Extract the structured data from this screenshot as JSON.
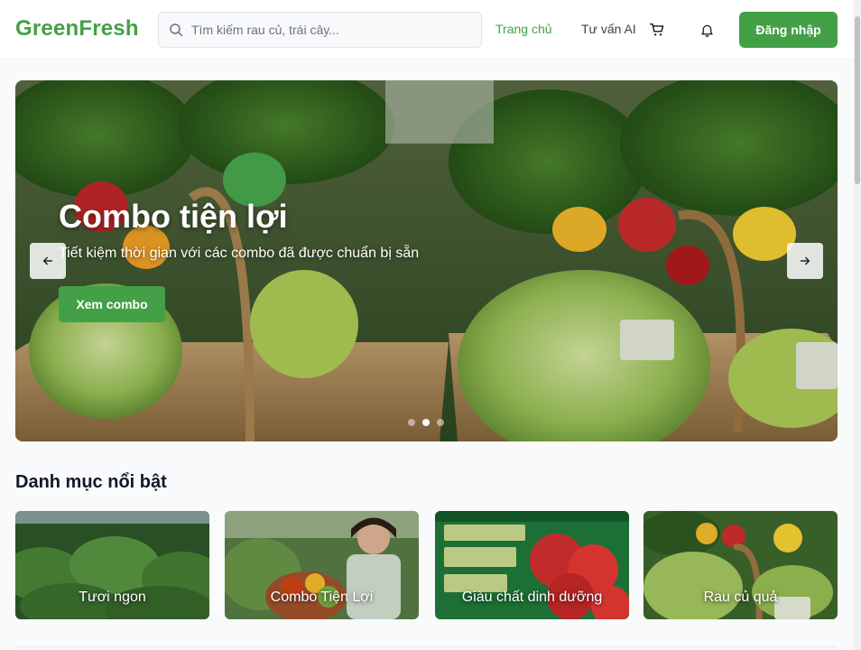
{
  "header": {
    "logo": "GreenFresh",
    "search_placeholder": "Tìm kiếm rau củ, trái cây...",
    "nav": [
      {
        "label": "Trang chủ",
        "active": true
      },
      {
        "label": "Tư vấn AI",
        "active": false
      }
    ],
    "icons": [
      "search-icon",
      "cart-icon",
      "bell-icon"
    ],
    "login_label": "Đăng nhập"
  },
  "hero": {
    "title": "Combo tiện lợi",
    "subtitle": "Tiết kiệm thời gian với các combo đã được chuẩn bị sẵn",
    "button_label": "Xem combo",
    "slide_count": 3,
    "active_slide": 2
  },
  "categories": {
    "title": "Danh mục nổi bật",
    "items": [
      {
        "label": "Tươi ngon"
      },
      {
        "label": "Combo Tiện Lợi"
      },
      {
        "label": "Giàu chất dinh dưỡng"
      },
      {
        "label": "Rau củ quả"
      }
    ]
  },
  "colors": {
    "brand": "#43a047",
    "text_dark": "#111827",
    "nav_text": "#374151"
  }
}
